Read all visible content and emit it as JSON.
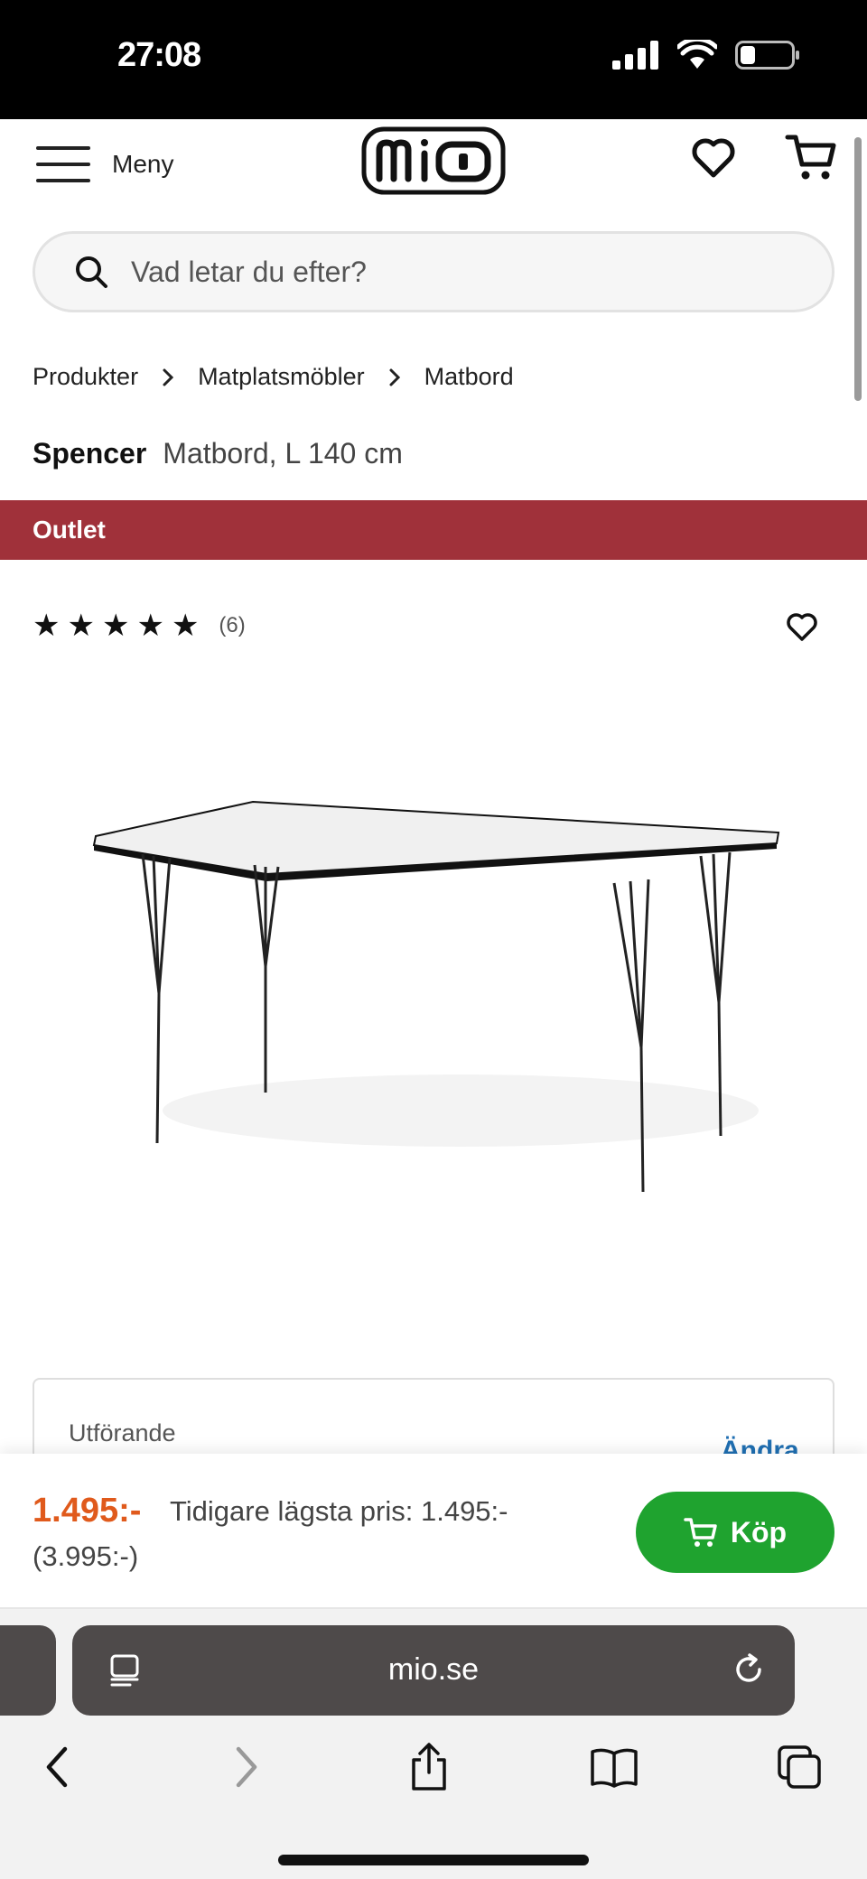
{
  "status_bar": {
    "time": "27:08"
  },
  "header": {
    "menu_label": "Meny",
    "logo_text": "mio"
  },
  "search": {
    "placeholder": "Vad letar du efter?"
  },
  "breadcrumb": [
    "Produkter",
    "Matplatsmöbler",
    "Matbord"
  ],
  "product": {
    "brand": "Spencer",
    "description": "Matbord, L 140 cm",
    "badge": "Outlet",
    "rating_stars": 5,
    "rating_count": "(6)"
  },
  "options": {
    "label": "Utförande",
    "change_label": "Ändra"
  },
  "buy_bar": {
    "price": "1.495:-",
    "previous_lowest": "Tidigare lägsta pris: 1.495:-",
    "original_price": "(3.995:-)",
    "buy_label": "Köp"
  },
  "browser": {
    "url": "mio.se"
  },
  "colors": {
    "outlet": "#a0313a",
    "price": "#e05a1c",
    "buy_button": "#1fa32f",
    "link": "#1f6fb2"
  }
}
